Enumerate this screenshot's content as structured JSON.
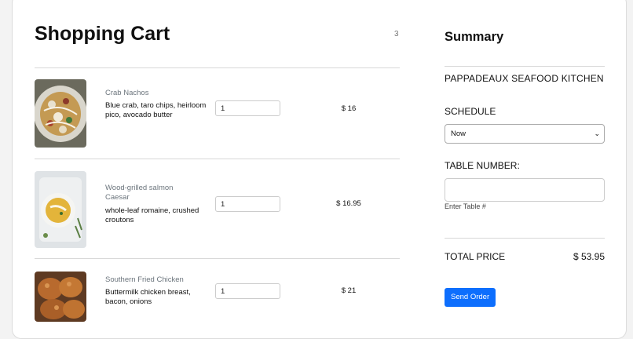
{
  "cart": {
    "title": "Shopping Cart",
    "count": "3",
    "items": [
      {
        "category": "Crab Nachos",
        "description": "Blue crab, taro chips, heirloom pico, avocado butter",
        "quantity": "1",
        "price": "$ 16",
        "image": "nachos-photo"
      },
      {
        "category": "Wood-grilled salmon Caesar",
        "description": "whole-leaf romaine, crushed croutons",
        "quantity": "1",
        "price": "$ 16.95",
        "image": "soup-photo"
      },
      {
        "category": "Southern Fried Chicken",
        "description": "Buttermilk chicken breast, bacon, onions",
        "quantity": "1",
        "price": "$ 21",
        "image": "fried-chicken-photo"
      }
    ]
  },
  "summary": {
    "title": "Summary",
    "restaurant": "PAPPADEAUX SEAFOOD KITCHEN",
    "schedule_label": "SCHEDULE",
    "schedule_value": "Now",
    "table_label": "TABLE NUMBER:",
    "table_help": "Enter Table #",
    "total_label": "TOTAL PRICE",
    "total_value": "$ 53.95",
    "send_label": "Send Order"
  },
  "colors": {
    "accent": "#0d6efd",
    "muted": "#6c757d"
  }
}
